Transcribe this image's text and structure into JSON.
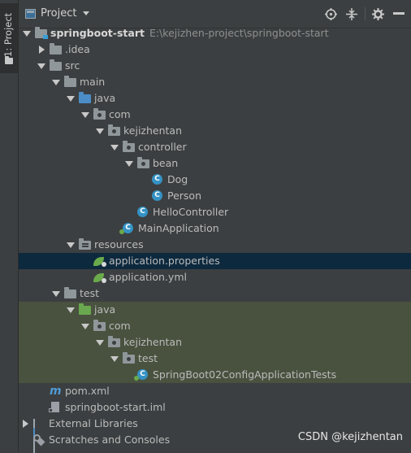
{
  "tool_strip": {
    "label": "1: Project"
  },
  "header": {
    "title": "Project"
  },
  "tree": [
    {
      "label": "springboot-start",
      "path": "E:\\kejizhen-project\\springboot-start",
      "icon": "module-folder-icon",
      "expanded": true,
      "bold": true
    },
    {
      "label": ".idea",
      "icon": "folder-icon",
      "expanded": false
    },
    {
      "label": "src",
      "icon": "folder-icon",
      "expanded": true
    },
    {
      "label": "main",
      "icon": "folder-icon",
      "expanded": true
    },
    {
      "label": "java",
      "icon": "source-folder-icon",
      "expanded": true
    },
    {
      "label": "com",
      "icon": "package-icon",
      "expanded": true
    },
    {
      "label": "kejizhentan",
      "icon": "package-icon",
      "expanded": true
    },
    {
      "label": "controller",
      "icon": "package-icon",
      "expanded": true
    },
    {
      "label": "bean",
      "icon": "package-icon",
      "expanded": true
    },
    {
      "label": "Dog",
      "icon": "class-icon"
    },
    {
      "label": "Person",
      "icon": "class-icon"
    },
    {
      "label": "HelloController",
      "icon": "class-icon"
    },
    {
      "label": "MainApplication",
      "icon": "spring-class-icon"
    },
    {
      "label": "resources",
      "icon": "resources-folder-icon",
      "expanded": true
    },
    {
      "label": "application.properties",
      "icon": "spring-config-icon",
      "selected": true
    },
    {
      "label": "application.yml",
      "icon": "spring-config-icon"
    },
    {
      "label": "test",
      "icon": "folder-icon",
      "expanded": true
    },
    {
      "label": "java",
      "icon": "test-folder-icon",
      "expanded": true
    },
    {
      "label": "com",
      "icon": "package-icon",
      "expanded": true
    },
    {
      "label": "kejizhentan",
      "icon": "package-icon",
      "expanded": true
    },
    {
      "label": "test",
      "icon": "package-icon",
      "expanded": true
    },
    {
      "label": "SpringBoot02ConfigApplicationTests",
      "icon": "spring-class-icon"
    },
    {
      "label": "pom.xml",
      "icon": "maven-icon"
    },
    {
      "label": "springboot-start.iml",
      "icon": "iml-file-icon"
    },
    {
      "label": "External Libraries",
      "icon": "libraries-icon",
      "expanded": false
    },
    {
      "label": "Scratches and Consoles",
      "icon": "scratches-icon"
    }
  ],
  "watermark": "CSDN @kejizhentan",
  "colors": {
    "selection": "#0d293e",
    "test_highlight": "#49523f",
    "background": "#3c3f41"
  }
}
